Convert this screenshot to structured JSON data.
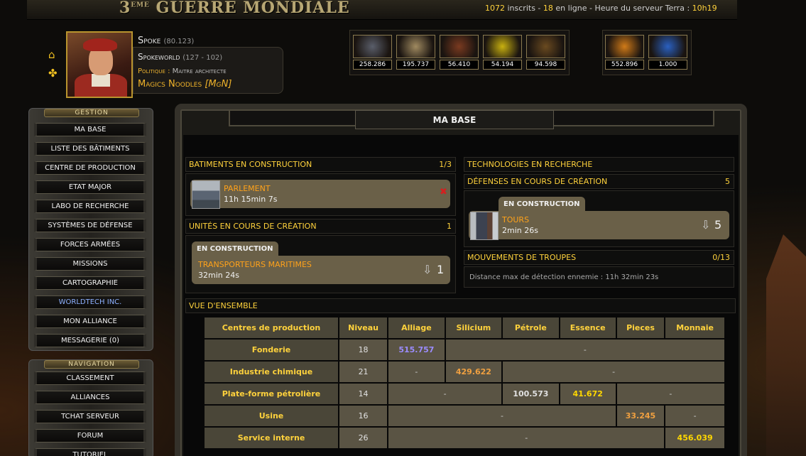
{
  "header": {
    "logo_sup": "EME",
    "logo_prefix": "3",
    "logo_text": "GUERRE MONDIALE",
    "registered": "1072",
    "registered_label": "inscrits -",
    "online": "18",
    "online_label": "en ligne - Heure du serveur Terra :",
    "server_time": "10h19"
  },
  "player": {
    "name": "Spoke",
    "coords": "(80.123)",
    "world": "Spokeworld",
    "world_coords": "(127 - 102)",
    "politics_label": "Politique :",
    "politics_value": "Maitre architecte",
    "alliance": "Magics Noodles",
    "alliance_tag": "[MgN]"
  },
  "resources": [
    {
      "icon": "alloy-icon",
      "value": "258.286",
      "color": "#5a5e6a"
    },
    {
      "icon": "silicon-icon",
      "value": "195.737",
      "color": "#a08a60"
    },
    {
      "icon": "oil-barrel-icon",
      "value": "56.410",
      "color": "#7a3a20"
    },
    {
      "icon": "fuel-drop-icon",
      "value": "54.194",
      "color": "#c8b010"
    },
    {
      "icon": "gear-parts-icon",
      "value": "94.598",
      "color": "#6a4a20"
    },
    {
      "icon": "coins-icon",
      "value": "552.896",
      "color": "#d07a18"
    },
    {
      "icon": "energy-icon",
      "value": "1.000",
      "color": "#2a60c0"
    }
  ],
  "menu": {
    "gestion_label": "GESTION",
    "gestion_items": [
      "MA BASE",
      "LISTE DES BÂTIMENTS",
      "CENTRE DE PRODUCTION",
      "ETAT MAJOR",
      "LABO DE RECHERCHE",
      "SYSTÈMES DE DÉFENSE",
      "FORCES ARMÉES",
      "MISSIONS",
      "CARTOGRAPHIE",
      "WORLDTECH INC.",
      "MON ALLIANCE",
      "MESSAGERIE (0)"
    ],
    "navigation_label": "NAVIGATION",
    "navigation_items": [
      "CLASSEMENT",
      "ALLIANCES",
      "TCHAT SERVEUR",
      "FORUM",
      "TUTORIEL"
    ]
  },
  "main": {
    "title": "MA BASE",
    "buildings": {
      "header": "BATIMENTS EN CONSTRUCTION",
      "count": "1/3",
      "item_name": "PARLEMENT",
      "item_time": "11h 15min 7s",
      "cancel_symbol": "✖"
    },
    "units": {
      "header": "UNITÉS EN COURS DE CRÉATION",
      "count": "1",
      "tab": "EN CONSTRUCTION",
      "item_name": "TRANSPORTEURS MARITIMES",
      "item_time": "32min 24s",
      "qty": "1"
    },
    "technologies": {
      "header": "TECHNOLOGIES EN RECHERCHE"
    },
    "defenses": {
      "header": "DÉFENSES EN COURS DE CRÉATION",
      "count": "5",
      "tab": "EN CONSTRUCTION",
      "item_name": "TOURS",
      "item_time": "2min 26s",
      "qty": "5"
    },
    "troops": {
      "header": "MOUVEMENTS DE TROUPES",
      "count": "0/13",
      "detection": "Distance max de détection ennemie : 11h 32min 23s"
    },
    "overview": {
      "header": "VUE D'ENSEMBLE",
      "columns": [
        "Centres de production",
        "Niveau",
        "Alliage",
        "Silicium",
        "Pétrole",
        "Essence",
        "Pieces",
        "Monnaie"
      ],
      "rows": [
        {
          "name": "Fonderie",
          "level": "18",
          "v1": "515.757",
          "dash": "-"
        },
        {
          "name": "Industrie chimique",
          "level": "21",
          "d1": "-",
          "v1": "429.622",
          "dash": "-"
        },
        {
          "name": "Plate-forme pétrolière",
          "level": "14",
          "d1": "-",
          "v1": "100.573",
          "v2": "41.672",
          "dash": "-"
        },
        {
          "name": "Usine",
          "level": "16",
          "d1": "-",
          "v1": "33.245",
          "dash": "-"
        },
        {
          "name": "Service interne",
          "level": "26",
          "d1": "-",
          "v1": "456.039"
        }
      ]
    }
  }
}
